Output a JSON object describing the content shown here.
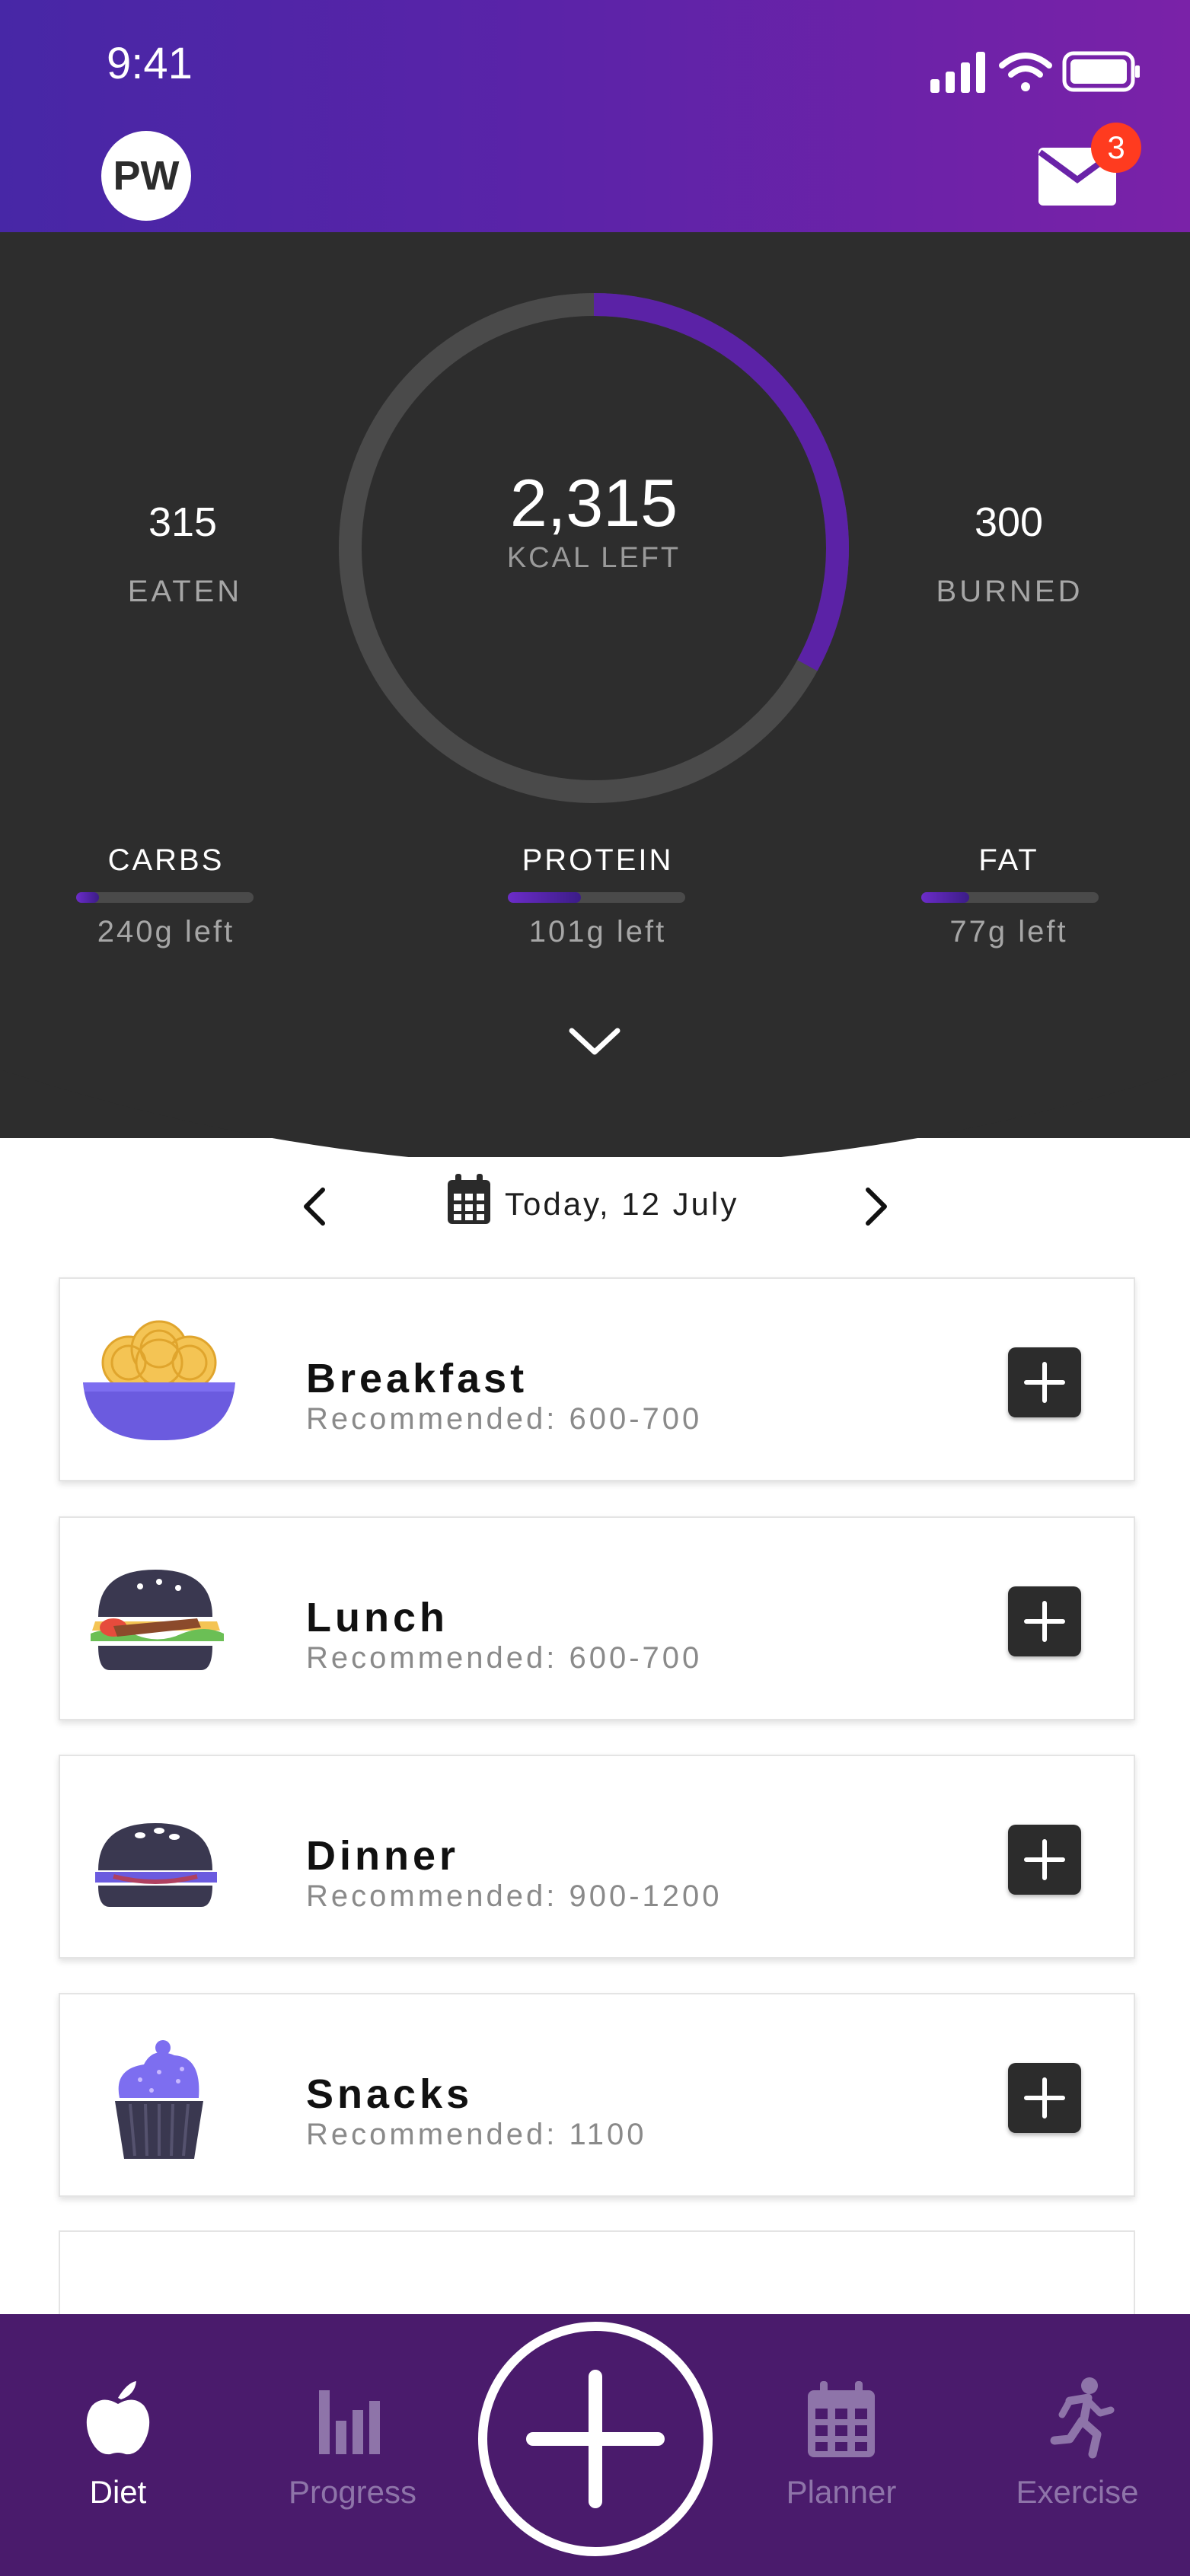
{
  "status_bar": {
    "time": "9:41"
  },
  "header": {
    "avatar_initials": "PW",
    "mail_badge_count": "3"
  },
  "summary": {
    "kcal_left": "2,315",
    "kcal_left_label": "KCAL LEFT",
    "calorie_progress": 0.33,
    "eaten_value": "315",
    "eaten_label": "EATEN",
    "burned_value": "300",
    "burned_label": "BURNED",
    "macros": [
      {
        "label": "CARBS",
        "left": "240g left",
        "progress": 0.13
      },
      {
        "label": "PROTEIN",
        "left": "101g left",
        "progress": 0.41
      },
      {
        "label": "FAT",
        "left": "77g left",
        "progress": 0.27
      }
    ]
  },
  "date_nav": {
    "date": "Today, 12 July"
  },
  "meals": [
    {
      "name": "Breakfast",
      "recommended": "Recommended: 600-700",
      "icon": "noodle-bowl-icon"
    },
    {
      "name": "Lunch",
      "recommended": "Recommended: 600-700",
      "icon": "burger-icon"
    },
    {
      "name": "Dinner",
      "recommended": "Recommended: 900-1200",
      "icon": "dark-burger-icon"
    },
    {
      "name": "Snacks",
      "recommended": "Recommended: 1100",
      "icon": "cupcake-icon"
    }
  ],
  "tabbar": {
    "tabs": [
      {
        "label": "Diet",
        "icon": "apple-icon",
        "active": true
      },
      {
        "label": "Progress",
        "icon": "bar-chart-icon",
        "active": false
      },
      {
        "label": "Planner",
        "icon": "calendar-icon",
        "active": false
      },
      {
        "label": "Exercise",
        "icon": "running-icon",
        "active": false
      }
    ]
  },
  "colors": {
    "header_gradient_start": "#4727a6",
    "header_gradient_end": "#7a22a8",
    "summary_bg": "#2d2d2d",
    "accent_purple": "#6c2cc9",
    "tabbar_bg": "#4a1b6c",
    "badge_red": "#ff3b1f"
  }
}
